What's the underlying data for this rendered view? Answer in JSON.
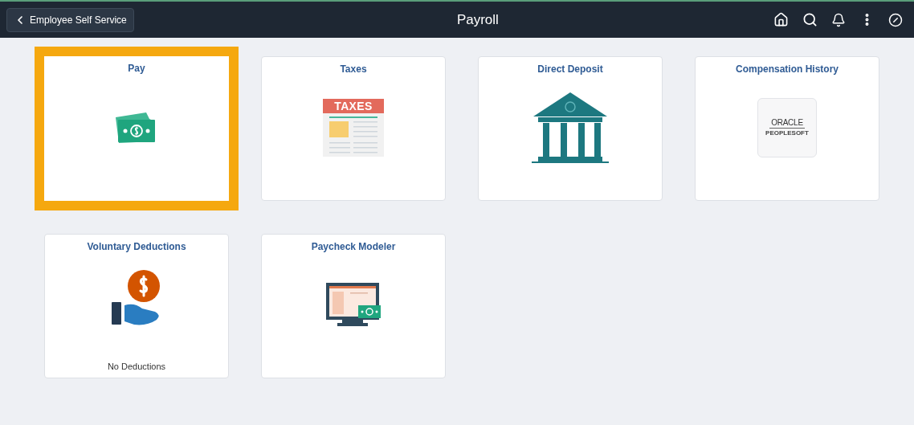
{
  "header": {
    "back_button": "Employee Self Service",
    "title": "Payroll"
  },
  "tiles": [
    {
      "title": "Pay",
      "kind": "money",
      "selected": true
    },
    {
      "title": "Taxes",
      "kind": "taxes",
      "selected": false,
      "icon_text": [
        "TAXES"
      ]
    },
    {
      "title": "Direct Deposit",
      "kind": "bank",
      "selected": false
    },
    {
      "title": "Compensation History",
      "kind": "logo",
      "selected": false,
      "icon_text": [
        "ORACLE",
        "PEOPLESOFT"
      ]
    },
    {
      "title": "Voluntary Deductions",
      "kind": "hand",
      "selected": false,
      "footer": "No Deductions"
    },
    {
      "title": "Paycheck Modeler",
      "kind": "monitor",
      "selected": false
    }
  ]
}
